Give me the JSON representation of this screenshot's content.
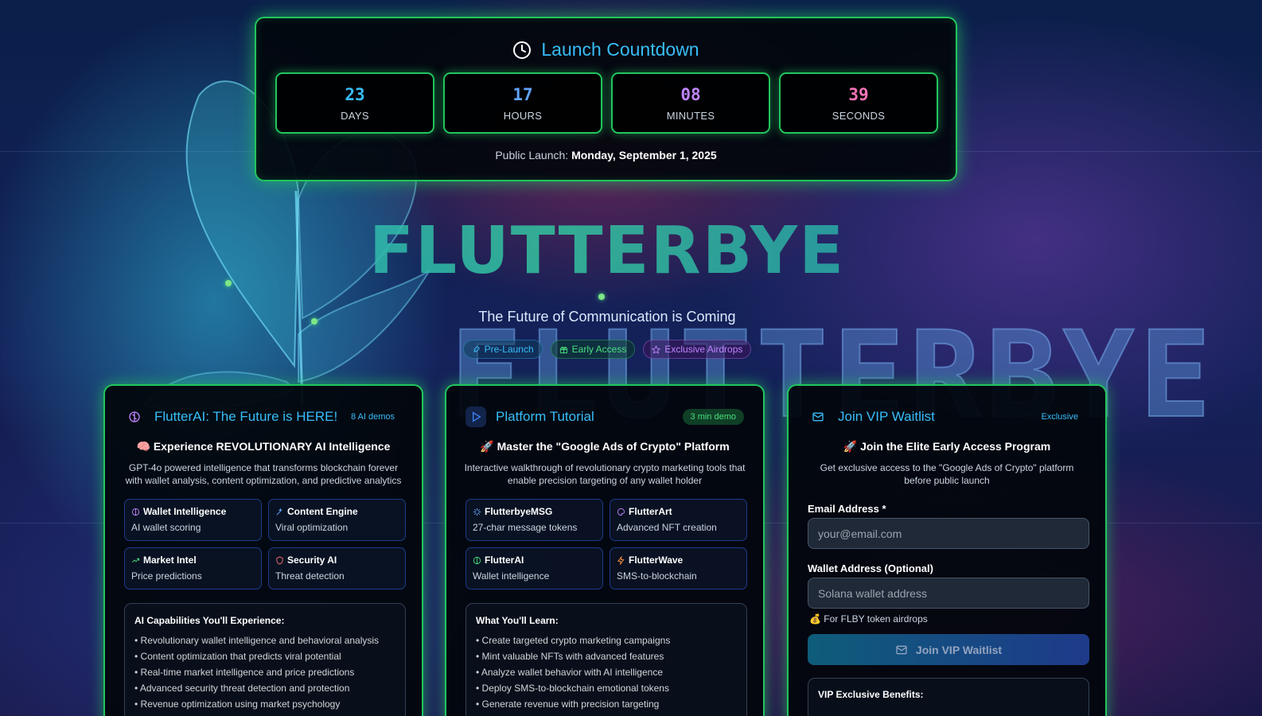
{
  "colors": {
    "accent_cyan": "#38bdf8",
    "neon_green": "#22c55e",
    "days": "#38bdf8",
    "hours": "#60a5fa",
    "minutes": "#c084fc",
    "seconds": "#f472b6"
  },
  "countdown": {
    "title": "Launch Countdown",
    "icon": "clock-icon",
    "units": [
      {
        "value": "23",
        "label": "DAYS"
      },
      {
        "value": "17",
        "label": "HOURS"
      },
      {
        "value": "08",
        "label": "MINUTES"
      },
      {
        "value": "39",
        "label": "SECONDS"
      }
    ],
    "footer_prefix": "Public Launch:",
    "footer_date": "Monday, September 1, 2025"
  },
  "hero": {
    "title": "FLUTTERBYE",
    "background_word": "FLUTTERBYE",
    "subtitle": "The Future of Communication is Coming",
    "badges": [
      {
        "label": "Pre-Launch",
        "icon": "rocket-icon"
      },
      {
        "label": "Early Access",
        "icon": "gift-icon"
      },
      {
        "label": "Exclusive Airdrops",
        "icon": "star-icon"
      }
    ]
  },
  "ai_card": {
    "title": "FlutterAI: The Future is HERE!",
    "pill": "8 AI demos",
    "icon": "brain-icon",
    "headline": "🧠 Experience REVOLUTIONARY AI Intelligence",
    "description": "GPT-4o powered intelligence that transforms blockchain forever with wallet analysis, content optimization, and predictive analytics",
    "features": [
      {
        "title": "Wallet Intelligence",
        "desc": "AI wallet scoring",
        "icon": "brain-icon"
      },
      {
        "title": "Content Engine",
        "desc": "Viral optimization",
        "icon": "wand-icon"
      },
      {
        "title": "Market Intel",
        "desc": "Price predictions",
        "icon": "trend-up-icon"
      },
      {
        "title": "Security AI",
        "desc": "Threat detection",
        "icon": "shield-icon"
      }
    ],
    "list_title": "AI Capabilities You'll Experience:",
    "list": [
      "• Revolutionary wallet intelligence and behavioral analysis",
      "• Content optimization that predicts viral potential",
      "• Real-time market intelligence and price predictions",
      "• Advanced security threat detection and protection",
      "• Revenue optimization using market psychology"
    ]
  },
  "tutorial_card": {
    "title": "Platform Tutorial",
    "pill": "3 min demo",
    "icon": "play-icon",
    "headline": "🚀 Master the \"Google Ads of Crypto\" Platform",
    "description": "Interactive walkthrough of revolutionary crypto marketing tools that enable precision targeting of any wallet holder",
    "features": [
      {
        "title": "FlutterbyeMSG",
        "desc": "27-char message tokens",
        "icon": "sparkle-icon"
      },
      {
        "title": "FlutterArt",
        "desc": "Advanced NFT creation",
        "icon": "palette-icon"
      },
      {
        "title": "FlutterAI",
        "desc": "Wallet intelligence",
        "icon": "brain-icon"
      },
      {
        "title": "FlutterWave",
        "desc": "SMS-to-blockchain",
        "icon": "bolt-icon"
      }
    ],
    "list_title": "What You'll Learn:",
    "list": [
      "• Create targeted crypto marketing campaigns",
      "• Mint valuable NFTs with advanced features",
      "• Analyze wallet behavior with AI intelligence",
      "• Deploy SMS-to-blockchain emotional tokens",
      "• Generate revenue with precision targeting"
    ]
  },
  "waitlist_card": {
    "title": "Join VIP Waitlist",
    "pill": "Exclusive",
    "icon": "mail-icon",
    "headline": "🚀 Join the Elite Early Access Program",
    "description": "Get exclusive access to the \"Google Ads of Crypto\" platform before public launch",
    "email_label": "Email Address *",
    "email_placeholder": "your@email.com",
    "wallet_label": "Wallet Address (Optional)",
    "wallet_placeholder": "Solana wallet address",
    "hint": "💰 For FLBY token airdrops",
    "button_label": "Join VIP Waitlist",
    "benefits_title": "VIP Exclusive Benefits:"
  }
}
